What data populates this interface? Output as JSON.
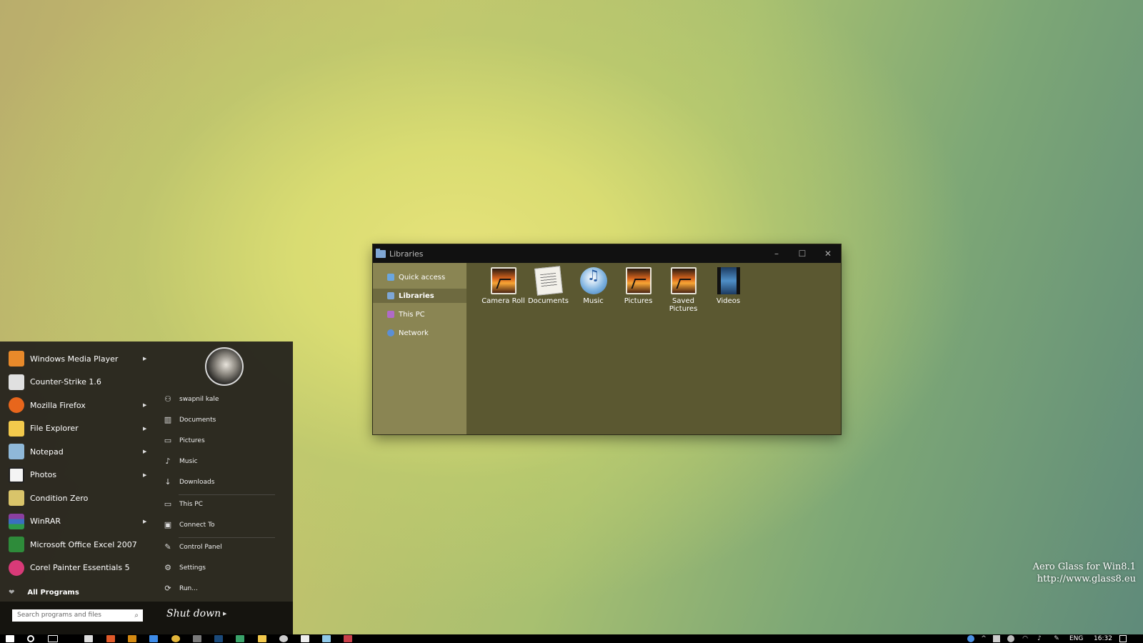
{
  "desktop": {
    "watermark_line1": "Aero Glass for Win8.1",
    "watermark_line2": "http://www.glass8.eu"
  },
  "explorer": {
    "title": "Libraries",
    "controls": {
      "minimize": "–",
      "maximize": "☐",
      "close": "✕"
    },
    "nav": [
      {
        "label": "Quick access",
        "icon": "star-icon",
        "active": false
      },
      {
        "label": "Libraries",
        "icon": "libraries-icon",
        "active": true
      },
      {
        "label": "This PC",
        "icon": "computer-icon",
        "active": false
      },
      {
        "label": "Network",
        "icon": "network-icon",
        "active": false
      }
    ],
    "items": [
      {
        "label": "Camera Roll",
        "icon": "pictures-folder-icon"
      },
      {
        "label": "Documents",
        "icon": "documents-folder-icon"
      },
      {
        "label": "Music",
        "icon": "music-folder-icon"
      },
      {
        "label": "Pictures",
        "icon": "pictures-folder-icon"
      },
      {
        "label": "Saved Pictures",
        "icon": "pictures-folder-icon"
      },
      {
        "label": "Videos",
        "icon": "videos-folder-icon"
      }
    ]
  },
  "start_menu": {
    "programs": [
      {
        "label": "Windows Media Player",
        "has_submenu": true,
        "color": "#e8892a"
      },
      {
        "label": "Counter-Strike 1.6",
        "has_submenu": false,
        "color": "#e0e0e0"
      },
      {
        "label": "Mozilla Firefox",
        "has_submenu": true,
        "color": "#e8661c"
      },
      {
        "label": "File Explorer",
        "has_submenu": true,
        "color": "#f2c94c"
      },
      {
        "label": "Notepad",
        "has_submenu": true,
        "color": "#8fb8d8"
      },
      {
        "label": "Photos",
        "has_submenu": true,
        "color": "#f4f4f4"
      },
      {
        "label": "Condition Zero",
        "has_submenu": false,
        "color": "#d9c46a"
      },
      {
        "label": "WinRAR",
        "has_submenu": true,
        "color": "#8a3fa0"
      },
      {
        "label": "Microsoft Office Excel 2007",
        "has_submenu": false,
        "color": "#2e8b3a"
      },
      {
        "label": "Corel Painter Essentials 5",
        "has_submenu": false,
        "color": "#d83a78"
      }
    ],
    "all_programs": "All Programs",
    "places": [
      {
        "label": "swapnil kale",
        "icon": "user-icon"
      },
      {
        "label": "Documents",
        "icon": "books-icon"
      },
      {
        "label": "Pictures",
        "icon": "image-icon"
      },
      {
        "label": "Music",
        "icon": "note-icon"
      },
      {
        "label": "Downloads",
        "icon": "download-icon"
      },
      {
        "label": "This PC",
        "icon": "laptop-icon"
      },
      {
        "label": "Connect To",
        "icon": "connect-icon"
      },
      {
        "label": "Control Panel",
        "icon": "wrench-icon"
      },
      {
        "label": "Settings",
        "icon": "gear-icon"
      },
      {
        "label": "Run...",
        "icon": "run-icon"
      }
    ],
    "search_placeholder": "Search programs and files",
    "shutdown_label": "Shut down"
  },
  "taskbar": {
    "language": "ENG",
    "time": "16:32"
  }
}
